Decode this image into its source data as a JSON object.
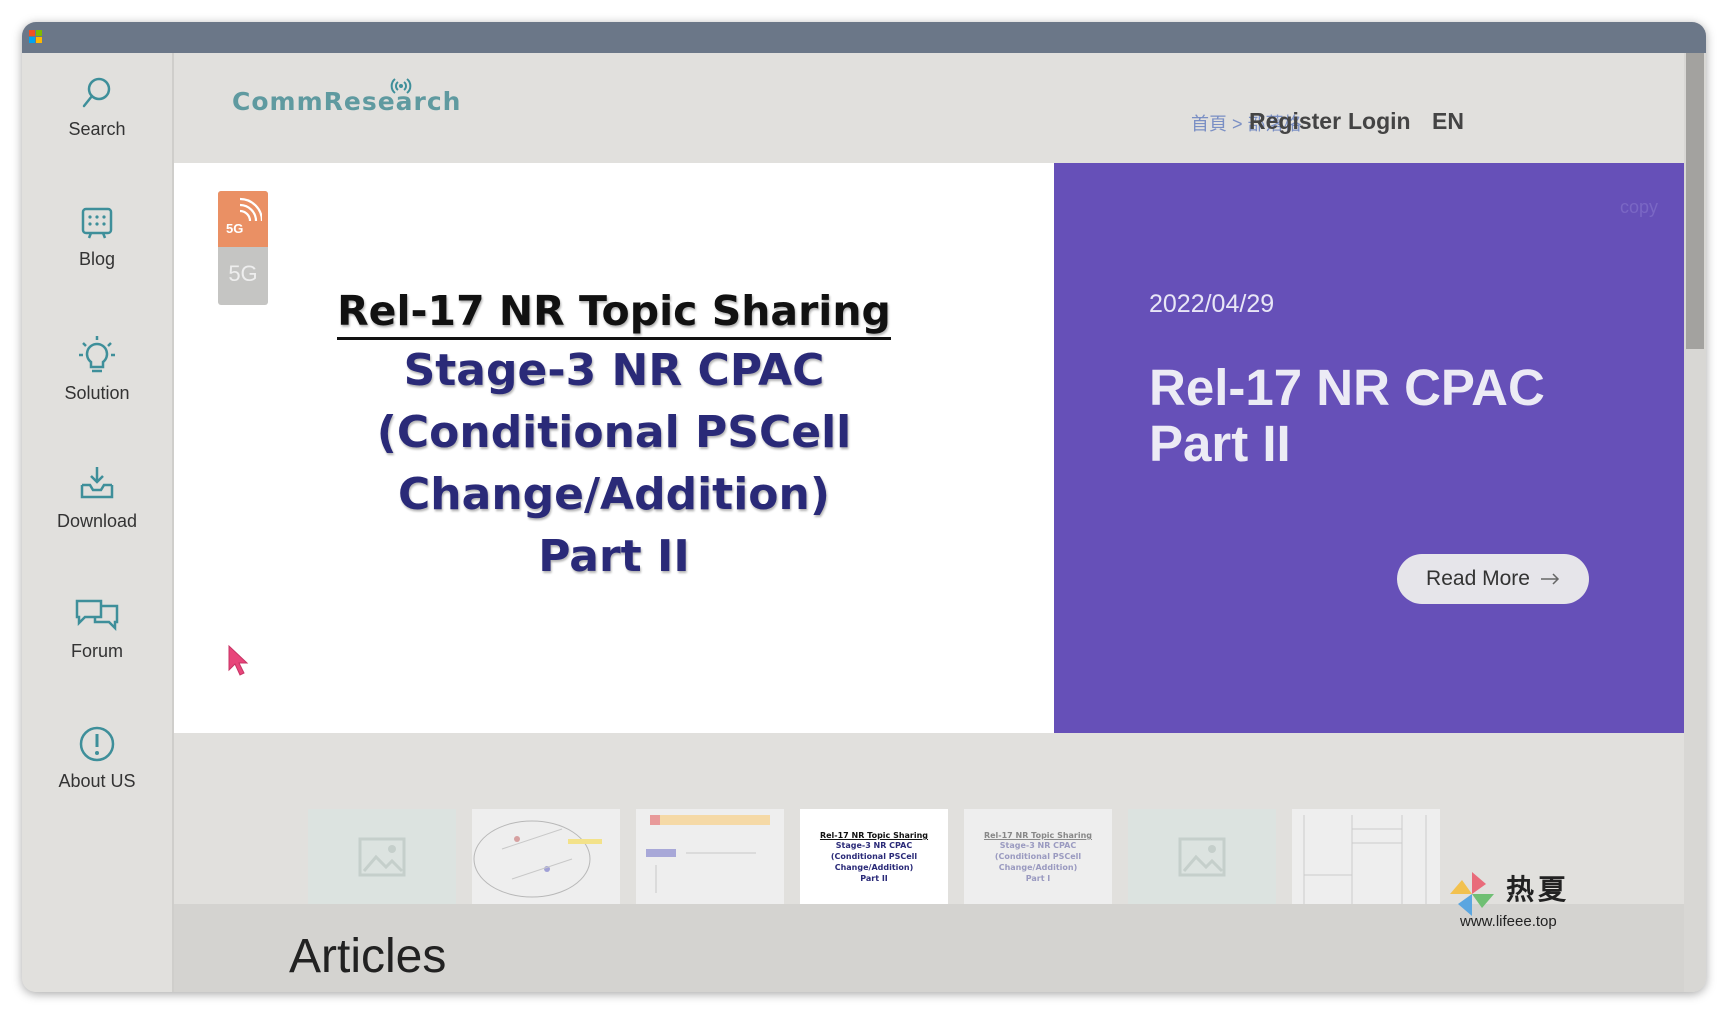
{
  "colors": {
    "titlebar": "#6b7788",
    "sidebar_bg": "#e1e0dd",
    "accent_teal": "#3e8f9a",
    "hero_purple": "#6650b8",
    "slide_navy": "#2a2a78",
    "badge_orange": "#ea9064",
    "cursor_pink": "#e8457a"
  },
  "sidebar": {
    "items": [
      {
        "label": "Search",
        "icon": "search-icon"
      },
      {
        "label": "Blog",
        "icon": "blog-icon"
      },
      {
        "label": "Solution",
        "icon": "lightbulb-icon"
      },
      {
        "label": "Download",
        "icon": "download-icon"
      },
      {
        "label": "Forum",
        "icon": "chat-icon"
      },
      {
        "label": "About US",
        "icon": "info-icon"
      }
    ]
  },
  "header": {
    "logo": "CommResearch",
    "breadcrumb": "首頁 > 部落格",
    "register": "Register",
    "login": "Login",
    "language": "EN"
  },
  "hero": {
    "badge_top": "5G",
    "badge_bottom": "5G",
    "slide_title": "Rel-17 NR Topic Sharing",
    "slide_subtitle_1": "Stage-3 NR CPAC",
    "slide_subtitle_2": "(Conditional PSCell Change/Addition)",
    "slide_subtitle_3": "Part II",
    "copy_label": "copy",
    "date": "2022/04/29",
    "title_line1": "Rel-17 NR CPAC",
    "title_line2": "Part II",
    "read_more": "Read More"
  },
  "thumbnails": [
    {
      "kind": "placeholder",
      "icon": "image-placeholder-icon"
    },
    {
      "kind": "diagram"
    },
    {
      "kind": "diagram"
    },
    {
      "kind": "slide",
      "active": true,
      "t1": "Rel-17 NR Topic Sharing",
      "t2": "Stage-3 NR CPAC",
      "t3": "(Conditional PSCell Change/Addition)",
      "t4": "Part II"
    },
    {
      "kind": "slide",
      "active": false,
      "t1": "Rel-17 NR Topic Sharing",
      "t2": "Stage-3 NR CPAC",
      "t3": "(Conditional PSCell Change/Addition)",
      "t4": "Part I"
    },
    {
      "kind": "placeholder",
      "icon": "image-placeholder-icon"
    },
    {
      "kind": "diagram"
    }
  ],
  "articles": {
    "heading": "Articles"
  },
  "watermark": {
    "name": "热夏",
    "url": "www.lifeee.top"
  }
}
